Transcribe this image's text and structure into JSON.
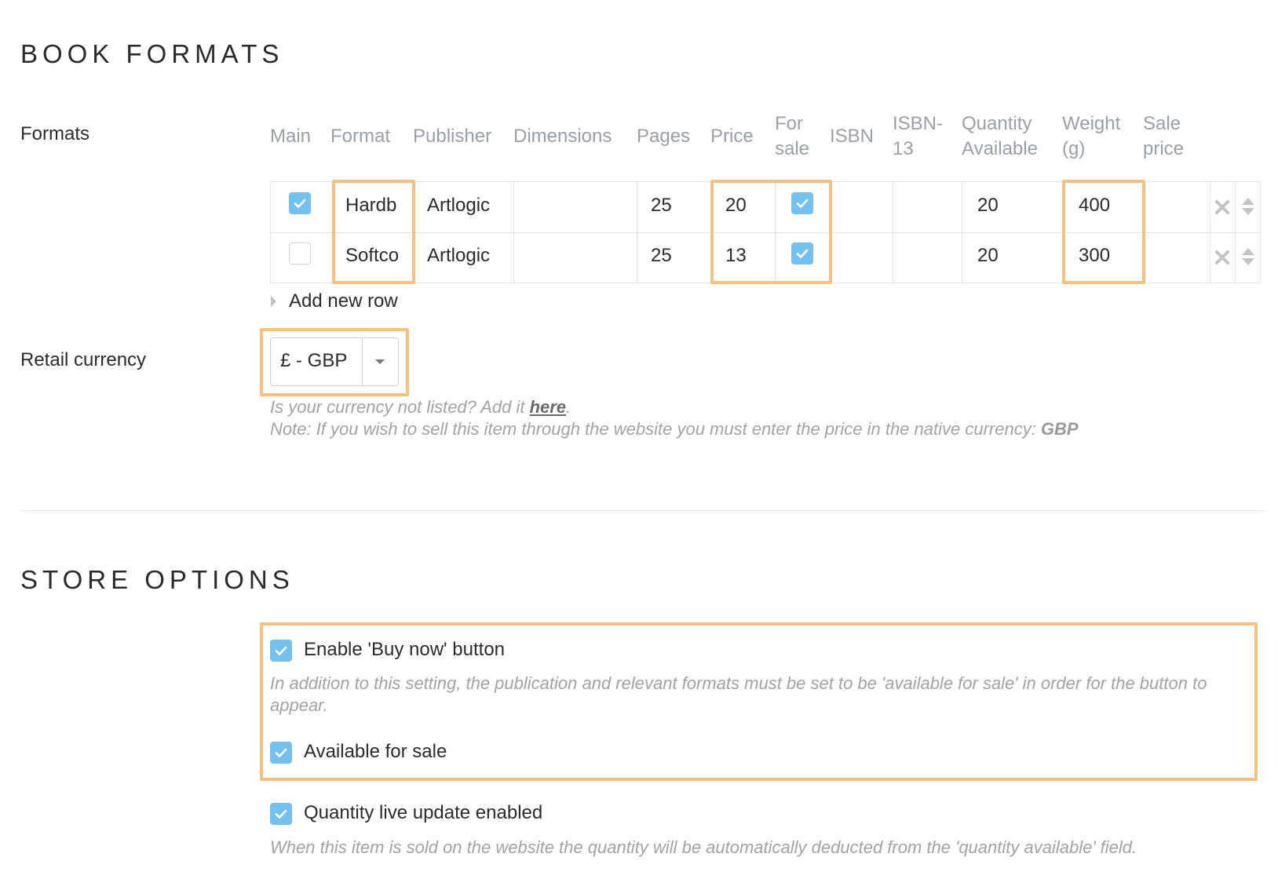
{
  "formats_section": {
    "title": "BOOK FORMATS",
    "formats_label": "Formats",
    "columns": [
      "Main",
      "Format",
      "Publisher",
      "Dimensions",
      "Pages",
      "Price",
      "For sale",
      "ISBN",
      "ISBN-13",
      "Quantity Available",
      "Weight (g)",
      "Sale price"
    ],
    "column_headers": {
      "main": "Main",
      "format": "Format",
      "publisher": "Publisher",
      "dimensions": "Dimensions",
      "pages": "Pages",
      "price": "Price",
      "for_sale_1": "For",
      "for_sale_2": "sale",
      "isbn": "ISBN",
      "isbn13_1": "ISBN-",
      "isbn13_2": "13",
      "qty_1": "Quantity",
      "qty_2": "Available",
      "weight_1": "Weight",
      "weight_2": "(g)",
      "sale_1": "Sale",
      "sale_2": "price"
    },
    "rows": [
      {
        "main": true,
        "format": "Hardb",
        "publisher": "Artlogic",
        "dimensions": "",
        "pages": "25",
        "price": "20",
        "for_sale": true,
        "isbn": "",
        "isbn13": "",
        "quantity": "20",
        "weight": "400",
        "sale_price": ""
      },
      {
        "main": false,
        "format": "Softco",
        "publisher": "Artlogic",
        "dimensions": "",
        "pages": "25",
        "price": "13",
        "for_sale": true,
        "isbn": "",
        "isbn13": "",
        "quantity": "20",
        "weight": "300",
        "sale_price": ""
      }
    ],
    "add_row_label": "Add new row",
    "retail_currency_label": "Retail currency",
    "currency_value": "£ - GBP",
    "currency_hint_prefix": "Is your currency not listed? Add it ",
    "currency_hint_link": "here",
    "currency_hint_suffix": ".",
    "currency_note_prefix": "Note: If you wish to sell this item through the website you must enter the price in the native currency: ",
    "currency_note_code": "GBP"
  },
  "store_section": {
    "title": "STORE OPTIONS",
    "buy_now_label": "Enable 'Buy now' button",
    "buy_now_desc": "In addition to this setting, the publication and relevant formats must be set to be 'available for sale' in order for the button to appear.",
    "available_label": "Available for sale",
    "qty_live_label": "Quantity live update enabled",
    "qty_live_desc": "When this item is sold on the website the quantity will be automatically deducted from the 'quantity available' field."
  },
  "colors": {
    "checkbox_on": "#74c0ef",
    "highlight": "#f8c17f"
  }
}
